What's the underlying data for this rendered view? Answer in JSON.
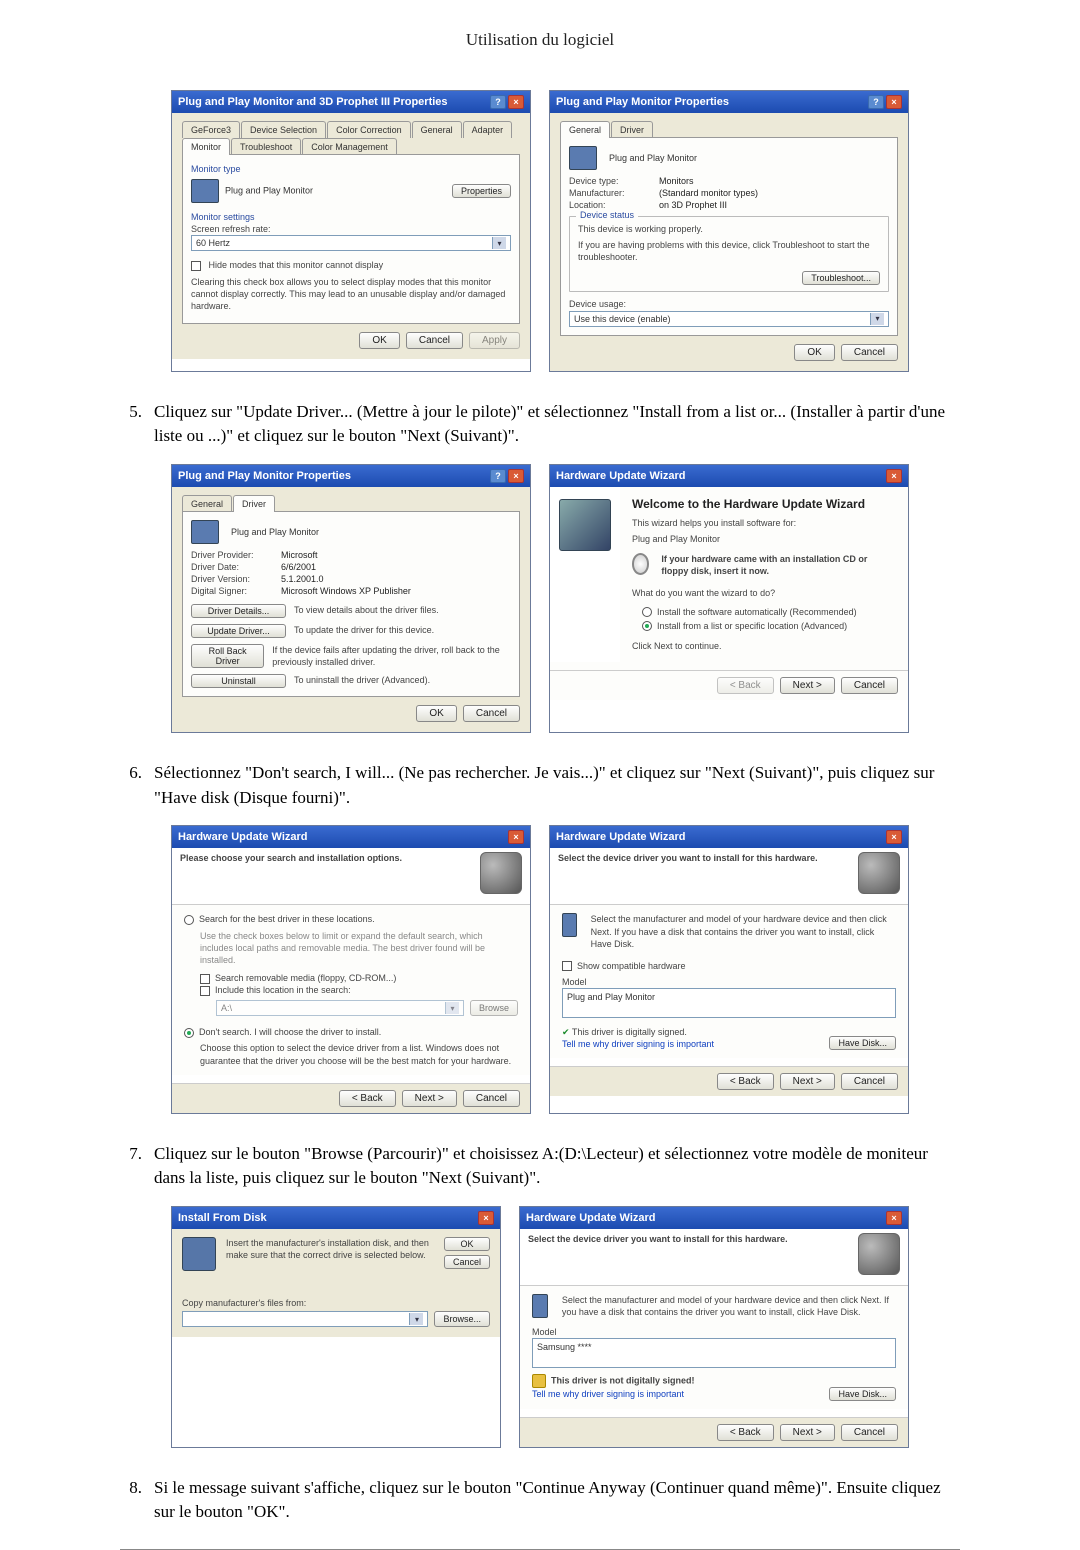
{
  "page_title": "Utilisation du logiciel",
  "steps": {
    "s5": "Cliquez sur \"Update Driver... (Mettre à jour le pilote)\" et sélectionnez \"Install from a list or... (Installer à partir d'une liste ou ...)\" et cliquez sur le bouton \"Next (Suivant)\".",
    "s6": "Sélectionnez \"Don't search, I will... (Ne pas rechercher. Je vais...)\" et cliquez sur \"Next (Suivant)\", puis cliquez sur \"Have disk (Disque fourni)\".",
    "s7": "Cliquez sur le bouton \"Browse (Parcourir)\" et choisissez A:(D:\\Lecteur) et sélectionnez votre modèle de moniteur dans la liste, puis cliquez sur le bouton \"Next (Suivant)\".",
    "s8": "Si le message suivant s'affiche, cliquez sur le bouton \"Continue Anyway (Continuer quand même)\". Ensuite cliquez sur le bouton \"OK\"."
  },
  "dlg1": {
    "title": "Plug and Play Monitor and 3D Prophet III Properties",
    "tabs": [
      "GeForce3",
      "Device Selection",
      "Color Correction",
      "General",
      "Adapter",
      "Monitor",
      "Troubleshoot",
      "Color Management"
    ],
    "monitor_type_label": "Monitor type",
    "monitor_name": "Plug and Play Monitor",
    "properties_btn": "Properties",
    "settings_label": "Monitor settings",
    "refresh_label": "Screen refresh rate:",
    "refresh_value": "60 Hertz",
    "hide_modes": "Hide modes that this monitor cannot display",
    "hide_desc": "Clearing this check box allows you to select display modes that this monitor cannot display correctly. This may lead to an unusable display and/or damaged hardware.",
    "ok": "OK",
    "cancel": "Cancel",
    "apply": "Apply"
  },
  "dlg2": {
    "title": "Plug and Play Monitor Properties",
    "tabs": [
      "General",
      "Driver"
    ],
    "header": "Plug and Play Monitor",
    "dev_type_label": "Device type:",
    "dev_type": "Monitors",
    "manu_label": "Manufacturer:",
    "manu": "(Standard monitor types)",
    "loc_label": "Location:",
    "loc": "on 3D Prophet III",
    "status_group": "Device status",
    "status_text": "This device is working properly.",
    "status_text2": "If you are having problems with this device, click Troubleshoot to start the troubleshooter.",
    "troubleshoot": "Troubleshoot...",
    "usage_label": "Device usage:",
    "usage_value": "Use this device (enable)",
    "ok": "OK",
    "cancel": "Cancel"
  },
  "dlg3": {
    "title": "Plug and Play Monitor Properties",
    "tabs": [
      "General",
      "Driver"
    ],
    "header": "Plug and Play Monitor",
    "prov_label": "Driver Provider:",
    "prov": "Microsoft",
    "date_label": "Driver Date:",
    "date": "6/6/2001",
    "ver_label": "Driver Version:",
    "ver": "5.1.2001.0",
    "sign_label": "Digital Signer:",
    "sign": "Microsoft Windows XP Publisher",
    "details_btn": "Driver Details...",
    "details_desc": "To view details about the driver files.",
    "update_btn": "Update Driver...",
    "update_desc": "To update the driver for this device.",
    "rollback_btn": "Roll Back Driver",
    "rollback_desc": "If the device fails after updating the driver, roll back to the previously installed driver.",
    "uninstall_btn": "Uninstall",
    "uninstall_desc": "To uninstall the driver (Advanced).",
    "ok": "OK",
    "cancel": "Cancel"
  },
  "dlg4": {
    "title": "Hardware Update Wizard",
    "welcome": "Welcome to the Hardware Update Wizard",
    "welcome_sub": "This wizard helps you install software for:",
    "device": "Plug and Play Monitor",
    "cd_note": "If your hardware came with an installation CD or floppy disk, insert it now.",
    "q": "What do you want the wizard to do?",
    "opt1": "Install the software automatically (Recommended)",
    "opt2": "Install from a list or specific location (Advanced)",
    "continue": "Click Next to continue.",
    "back": "< Back",
    "next": "Next >",
    "cancel": "Cancel"
  },
  "dlg5": {
    "title": "Hardware Update Wizard",
    "banner": "Please choose your search and installation options.",
    "opt1": "Search for the best driver in these locations.",
    "opt1_desc": "Use the check boxes below to limit or expand the default search, which includes local paths and removable media. The best driver found will be installed.",
    "chk1": "Search removable media (floppy, CD-ROM...)",
    "chk2": "Include this location in the search:",
    "loc": "A:\\",
    "browse": "Browse",
    "opt2": "Don't search. I will choose the driver to install.",
    "opt2_desc": "Choose this option to select the device driver from a list. Windows does not guarantee that the driver you choose will be the best match for your hardware.",
    "back": "< Back",
    "next": "Next >",
    "cancel": "Cancel"
  },
  "dlg6": {
    "title": "Hardware Update Wizard",
    "banner": "Select the device driver you want to install for this hardware.",
    "desc": "Select the manufacturer and model of your hardware device and then click Next. If you have a disk that contains the driver you want to install, click Have Disk.",
    "compat": "Show compatible hardware",
    "model": "Model",
    "model_item": "Plug and Play Monitor",
    "signed": "This driver is digitally signed.",
    "tell_why": "Tell me why driver signing is important",
    "have_disk": "Have Disk...",
    "back": "< Back",
    "next": "Next >",
    "cancel": "Cancel"
  },
  "dlg7": {
    "title": "Install From Disk",
    "text1": "Insert the manufacturer's installation disk, and then make sure that the correct drive is selected below.",
    "ok": "OK",
    "cancel": "Cancel",
    "copy_label": "Copy manufacturer's files from:",
    "path": "",
    "browse": "Browse..."
  },
  "dlg8": {
    "title": "Hardware Update Wizard",
    "banner": "Select the device driver you want to install for this hardware.",
    "desc": "Select the manufacturer and model of your hardware device and then click Next. If you have a disk that contains the driver you want to install, click Have Disk.",
    "model": "Model",
    "model_item": "Samsung ****",
    "not_signed": "This driver is not digitally signed!",
    "tell_why": "Tell me why driver signing is important",
    "have_disk": "Have Disk...",
    "back": "< Back",
    "next": "Next >",
    "cancel": "Cancel"
  }
}
